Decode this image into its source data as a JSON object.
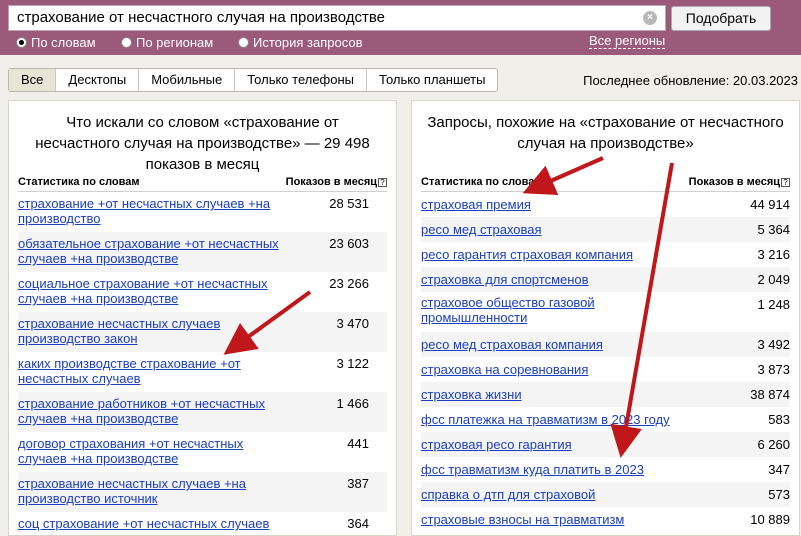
{
  "search": {
    "query": "страхование от несчастного случая на производстве",
    "button_label": "Подобрать",
    "modes": [
      "По словам",
      "По регионам",
      "История запросов"
    ],
    "regions_label": "Все регионы"
  },
  "tabs": [
    "Все",
    "Десктопы",
    "Мобильные",
    "Только телефоны",
    "Только планшеты"
  ],
  "updated": "Последнее обновление: 20.03.2023",
  "left": {
    "title": "Что искали со словом «страхование от несчастного случая на производстве» — 29 498 показов в месяц",
    "col1": "Статистика по словам",
    "col2": "Показов в месяц",
    "rows": [
      {
        "phrase": "страхование +от несчастных случаев +на производство",
        "count": "28 531"
      },
      {
        "phrase": "обязательное страхование +от несчастных случаев +на производстве",
        "count": "23 603"
      },
      {
        "phrase": "социальное страхование +от несчастных случаев +на производстве",
        "count": "23 266"
      },
      {
        "phrase": "страхование несчастных случаев производство закон",
        "count": "3 470"
      },
      {
        "phrase": "каких производстве страхование +от несчастных случаев",
        "count": "3 122"
      },
      {
        "phrase": "страхование работников +от несчастных случаев +на производстве",
        "count": "1 466"
      },
      {
        "phrase": "договор страхования +от несчастных случаев +на производстве",
        "count": "441"
      },
      {
        "phrase": "страхование несчастных случаев +на производство источник",
        "count": "387"
      },
      {
        "phrase": "соц страхование +от несчастных случаев",
        "count": "364"
      }
    ]
  },
  "right": {
    "title": "Запросы, похожие на «страхование от несчастного случая на производстве»",
    "col1": "Статистика по словам",
    "col2": "Показов в месяц",
    "rows": [
      {
        "phrase": "страховая премия",
        "count": "44 914"
      },
      {
        "phrase": "ресо мед страховая",
        "count": "5 364"
      },
      {
        "phrase": "ресо гарантия страховая компания",
        "count": "3 216"
      },
      {
        "phrase": "страховка для спортсменов",
        "count": "2 049"
      },
      {
        "phrase": "страховое общество газовой промышленности",
        "count": "1 248"
      },
      {
        "phrase": "ресо мед страховая компания",
        "count": "3 492"
      },
      {
        "phrase": "страховка на соревнования",
        "count": "3 873"
      },
      {
        "phrase": "страховка жизни",
        "count": "38 874"
      },
      {
        "phrase": "фсс платежка на травматизм в 2023 году",
        "count": "583"
      },
      {
        "phrase": "страховая ресо гарантия",
        "count": "6 260"
      },
      {
        "phrase": "фсс травматизм куда платить в 2023",
        "count": "347"
      },
      {
        "phrase": "справка о дтп для страховой",
        "count": "573"
      },
      {
        "phrase": "страховые взносы на травматизм",
        "count": "10 889"
      }
    ]
  },
  "colors": {
    "header": "#9b5a7a",
    "link": "#1a3dc1",
    "arrow": "#c0171a"
  }
}
